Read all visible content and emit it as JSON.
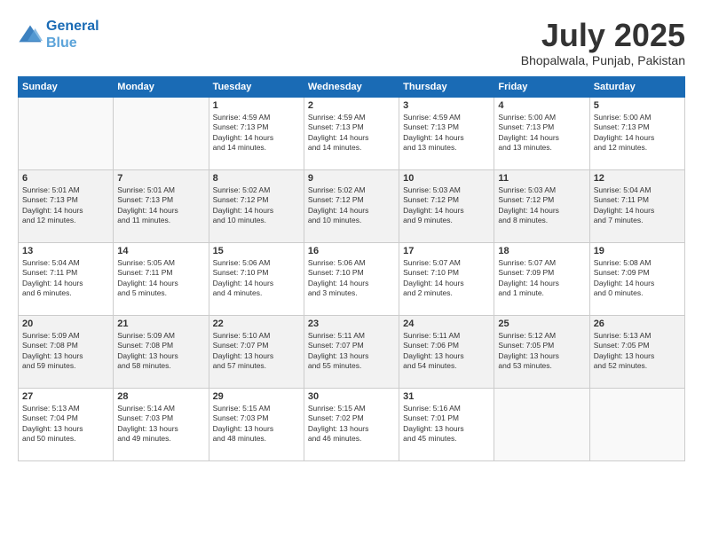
{
  "header": {
    "logo_line1": "General",
    "logo_line2": "Blue",
    "month": "July 2025",
    "location": "Bhopalwala, Punjab, Pakistan"
  },
  "weekdays": [
    "Sunday",
    "Monday",
    "Tuesday",
    "Wednesday",
    "Thursday",
    "Friday",
    "Saturday"
  ],
  "rows": [
    [
      {
        "num": "",
        "info": ""
      },
      {
        "num": "",
        "info": ""
      },
      {
        "num": "1",
        "info": "Sunrise: 4:59 AM\nSunset: 7:13 PM\nDaylight: 14 hours\nand 14 minutes."
      },
      {
        "num": "2",
        "info": "Sunrise: 4:59 AM\nSunset: 7:13 PM\nDaylight: 14 hours\nand 14 minutes."
      },
      {
        "num": "3",
        "info": "Sunrise: 4:59 AM\nSunset: 7:13 PM\nDaylight: 14 hours\nand 13 minutes."
      },
      {
        "num": "4",
        "info": "Sunrise: 5:00 AM\nSunset: 7:13 PM\nDaylight: 14 hours\nand 13 minutes."
      },
      {
        "num": "5",
        "info": "Sunrise: 5:00 AM\nSunset: 7:13 PM\nDaylight: 14 hours\nand 12 minutes."
      }
    ],
    [
      {
        "num": "6",
        "info": "Sunrise: 5:01 AM\nSunset: 7:13 PM\nDaylight: 14 hours\nand 12 minutes."
      },
      {
        "num": "7",
        "info": "Sunrise: 5:01 AM\nSunset: 7:13 PM\nDaylight: 14 hours\nand 11 minutes."
      },
      {
        "num": "8",
        "info": "Sunrise: 5:02 AM\nSunset: 7:12 PM\nDaylight: 14 hours\nand 10 minutes."
      },
      {
        "num": "9",
        "info": "Sunrise: 5:02 AM\nSunset: 7:12 PM\nDaylight: 14 hours\nand 10 minutes."
      },
      {
        "num": "10",
        "info": "Sunrise: 5:03 AM\nSunset: 7:12 PM\nDaylight: 14 hours\nand 9 minutes."
      },
      {
        "num": "11",
        "info": "Sunrise: 5:03 AM\nSunset: 7:12 PM\nDaylight: 14 hours\nand 8 minutes."
      },
      {
        "num": "12",
        "info": "Sunrise: 5:04 AM\nSunset: 7:11 PM\nDaylight: 14 hours\nand 7 minutes."
      }
    ],
    [
      {
        "num": "13",
        "info": "Sunrise: 5:04 AM\nSunset: 7:11 PM\nDaylight: 14 hours\nand 6 minutes."
      },
      {
        "num": "14",
        "info": "Sunrise: 5:05 AM\nSunset: 7:11 PM\nDaylight: 14 hours\nand 5 minutes."
      },
      {
        "num": "15",
        "info": "Sunrise: 5:06 AM\nSunset: 7:10 PM\nDaylight: 14 hours\nand 4 minutes."
      },
      {
        "num": "16",
        "info": "Sunrise: 5:06 AM\nSunset: 7:10 PM\nDaylight: 14 hours\nand 3 minutes."
      },
      {
        "num": "17",
        "info": "Sunrise: 5:07 AM\nSunset: 7:10 PM\nDaylight: 14 hours\nand 2 minutes."
      },
      {
        "num": "18",
        "info": "Sunrise: 5:07 AM\nSunset: 7:09 PM\nDaylight: 14 hours\nand 1 minute."
      },
      {
        "num": "19",
        "info": "Sunrise: 5:08 AM\nSunset: 7:09 PM\nDaylight: 14 hours\nand 0 minutes."
      }
    ],
    [
      {
        "num": "20",
        "info": "Sunrise: 5:09 AM\nSunset: 7:08 PM\nDaylight: 13 hours\nand 59 minutes."
      },
      {
        "num": "21",
        "info": "Sunrise: 5:09 AM\nSunset: 7:08 PM\nDaylight: 13 hours\nand 58 minutes."
      },
      {
        "num": "22",
        "info": "Sunrise: 5:10 AM\nSunset: 7:07 PM\nDaylight: 13 hours\nand 57 minutes."
      },
      {
        "num": "23",
        "info": "Sunrise: 5:11 AM\nSunset: 7:07 PM\nDaylight: 13 hours\nand 55 minutes."
      },
      {
        "num": "24",
        "info": "Sunrise: 5:11 AM\nSunset: 7:06 PM\nDaylight: 13 hours\nand 54 minutes."
      },
      {
        "num": "25",
        "info": "Sunrise: 5:12 AM\nSunset: 7:05 PM\nDaylight: 13 hours\nand 53 minutes."
      },
      {
        "num": "26",
        "info": "Sunrise: 5:13 AM\nSunset: 7:05 PM\nDaylight: 13 hours\nand 52 minutes."
      }
    ],
    [
      {
        "num": "27",
        "info": "Sunrise: 5:13 AM\nSunset: 7:04 PM\nDaylight: 13 hours\nand 50 minutes."
      },
      {
        "num": "28",
        "info": "Sunrise: 5:14 AM\nSunset: 7:03 PM\nDaylight: 13 hours\nand 49 minutes."
      },
      {
        "num": "29",
        "info": "Sunrise: 5:15 AM\nSunset: 7:03 PM\nDaylight: 13 hours\nand 48 minutes."
      },
      {
        "num": "30",
        "info": "Sunrise: 5:15 AM\nSunset: 7:02 PM\nDaylight: 13 hours\nand 46 minutes."
      },
      {
        "num": "31",
        "info": "Sunrise: 5:16 AM\nSunset: 7:01 PM\nDaylight: 13 hours\nand 45 minutes."
      },
      {
        "num": "",
        "info": ""
      },
      {
        "num": "",
        "info": ""
      }
    ]
  ]
}
